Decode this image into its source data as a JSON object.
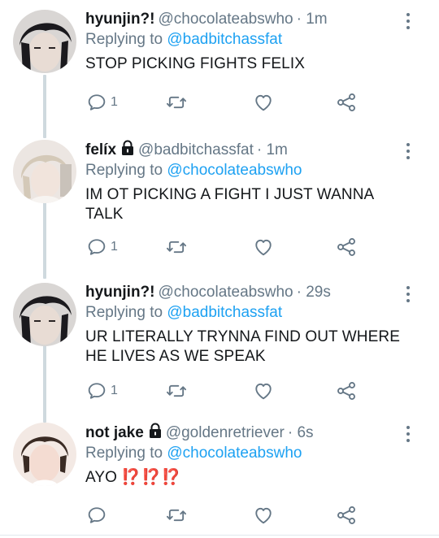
{
  "tweets": [
    {
      "display_name": "hyunjin?!",
      "handle": "@chocolateabswho",
      "time": "· 1m",
      "replying_label": "Replying to",
      "replying_to": "@badbitchassfat",
      "text": "STOP PICKING FIGHTS FELIX",
      "reply_count": "1",
      "locked": false
    },
    {
      "display_name": "felíx",
      "handle": "@badbitchassfat",
      "time": "· 1m",
      "replying_label": "Replying to",
      "replying_to": "@chocolateabswho",
      "text": "IM  OT PICKING A FIGHT I JUST WANNA TALK",
      "reply_count": "1",
      "locked": true
    },
    {
      "display_name": "hyunjin?!",
      "handle": "@chocolateabswho",
      "time": "· 29s",
      "replying_label": "Replying to",
      "replying_to": "@badbitchassfat",
      "text": "UR LITERALLY TRYNNA FIND OUT WHERE HE LIVES AS WE SPEAK",
      "reply_count": "1",
      "locked": false
    },
    {
      "display_name": "not jake",
      "handle": "@goldenretriever",
      "time": "· 6s",
      "replying_label": "Replying to",
      "replying_to": "@chocolateabswho",
      "text": "AYO",
      "emoji_text": "⁉️⁉️⁉️",
      "reply_count": "",
      "locked": true
    }
  ],
  "icons": {
    "reply": "reply-icon",
    "retweet": "retweet-icon",
    "like": "heart-icon",
    "share": "share-icon",
    "more": "more-vertical-icon",
    "lock": "lock-icon"
  },
  "colors": {
    "mention": "#1da1f2",
    "secondary_text": "#657786",
    "primary_text": "#14171a",
    "thread_line": "#cfd9de",
    "emoji_red": "#e0243c"
  }
}
